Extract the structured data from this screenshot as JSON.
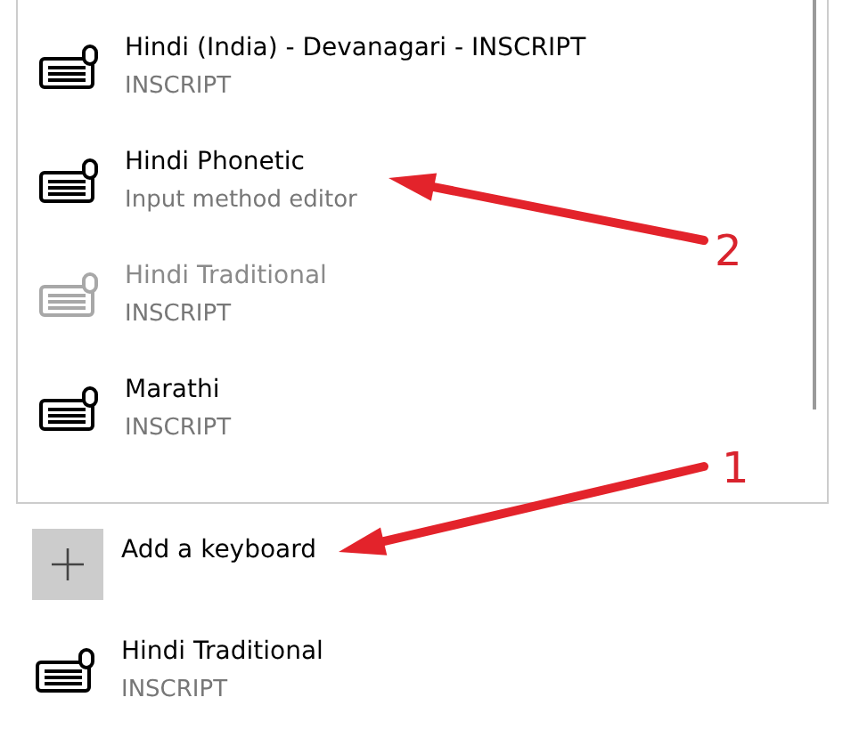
{
  "keyboard_list": {
    "items": [
      {
        "name": "Hindi (India) - Devanagari - INSCRIPT",
        "layout": "INSCRIPT",
        "disabled": false
      },
      {
        "name": "Hindi Phonetic",
        "layout": "Input method editor",
        "disabled": false
      },
      {
        "name": "Hindi Traditional",
        "layout": "INSCRIPT",
        "disabled": true
      },
      {
        "name": "Marathi",
        "layout": "INSCRIPT",
        "disabled": false
      }
    ]
  },
  "add_keyboard": {
    "label": "Add a keyboard"
  },
  "installed_keyboards": [
    {
      "name": "Hindi Traditional",
      "layout": "INSCRIPT"
    }
  ],
  "annotations": [
    {
      "label": "2"
    },
    {
      "label": "1"
    }
  ]
}
